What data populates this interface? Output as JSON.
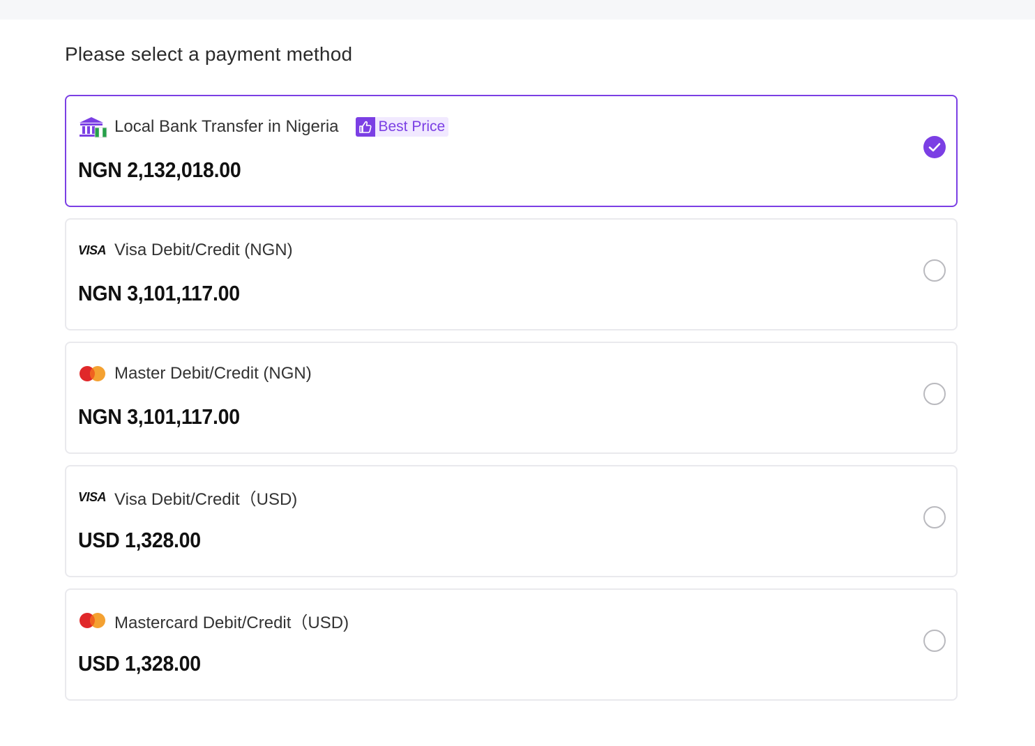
{
  "page": {
    "title": "Please select a payment method"
  },
  "colors": {
    "accent": "#7b3fe4",
    "card_border": "#e9e9ed",
    "radio_border": "#b9b9be",
    "visa_text": "#111111",
    "mastercard_red": "#e0282a",
    "mastercard_orange": "#f39c26"
  },
  "methods": [
    {
      "name": "Local Bank Transfer in Nigeria",
      "icon": "bank-nigeria-icon",
      "badge": "Best Price",
      "badge_icon": "thumbs-up-icon",
      "price": "NGN 2,132,018.00",
      "selected": true
    },
    {
      "name": "Visa Debit/Credit (NGN)",
      "icon": "visa-icon",
      "logo_text": "VISA",
      "price": "NGN 3,101,117.00",
      "selected": false
    },
    {
      "name": "Master Debit/Credit (NGN)",
      "icon": "mastercard-icon",
      "price": "NGN 3,101,117.00",
      "selected": false
    },
    {
      "name": "Visa Debit/Credit（USD)",
      "icon": "visa-icon",
      "logo_text": "VISA",
      "price": "USD 1,328.00",
      "selected": false
    },
    {
      "name": "Mastercard Debit/Credit（USD)",
      "icon": "mastercard-icon",
      "price": "USD 1,328.00",
      "selected": false
    }
  ]
}
